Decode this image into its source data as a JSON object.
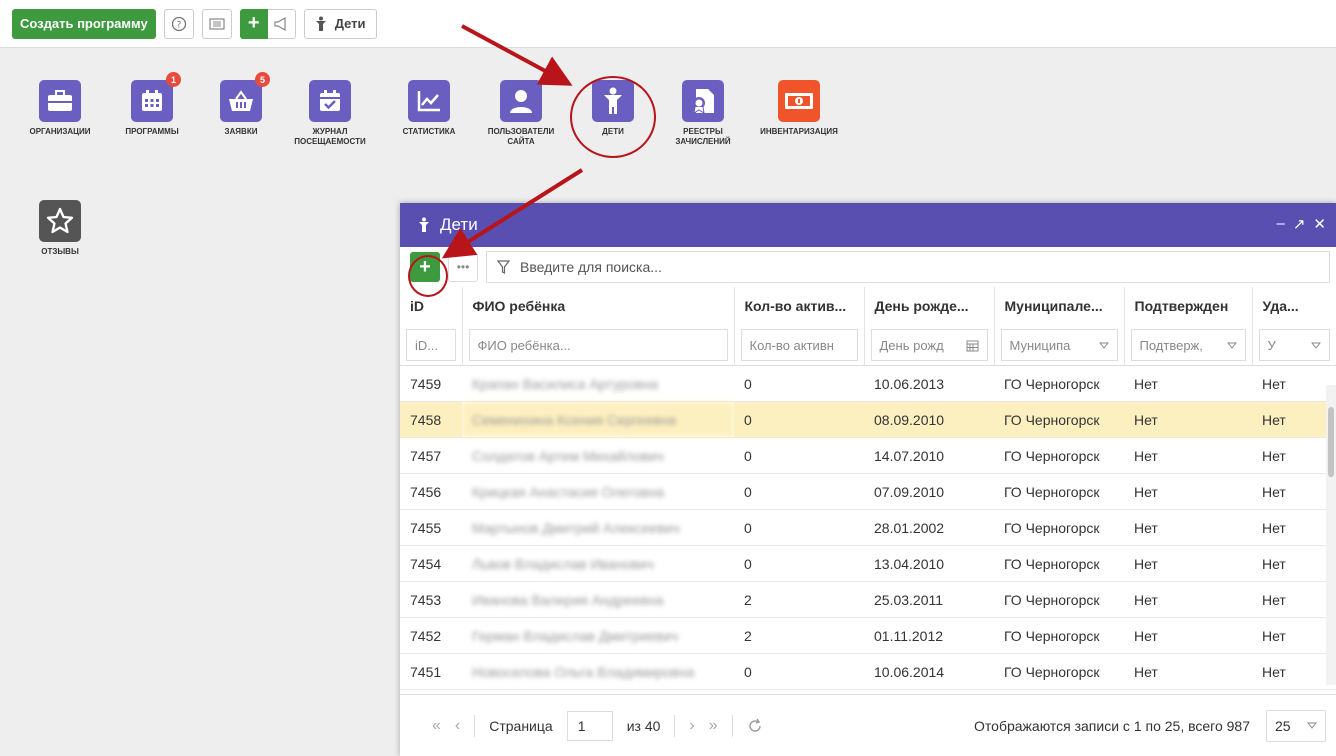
{
  "toolbar": {
    "create_label": "Создать программу",
    "help_icon": "help-icon",
    "deti_label": "Дети"
  },
  "desktop": {
    "icons": [
      {
        "label": "Организации",
        "icon": "briefcase-icon",
        "badge": ""
      },
      {
        "label": "Программы",
        "icon": "calendar-icon",
        "badge": "1"
      },
      {
        "label": "Заявки",
        "icon": "basket-icon",
        "badge": "5"
      },
      {
        "label": "Журнал посещаемости",
        "icon": "calendar-check-icon",
        "badge": ""
      },
      {
        "label": "Статистика",
        "icon": "chart-icon",
        "badge": ""
      },
      {
        "label": "Пользователи сайта",
        "icon": "user-icon",
        "badge": ""
      },
      {
        "label": "Дети",
        "icon": "child-icon",
        "badge": ""
      },
      {
        "label": "Реестры зачислений",
        "icon": "certificate-icon",
        "badge": ""
      },
      {
        "label": "Инвентаризация",
        "icon": "money-icon",
        "badge": ""
      },
      {
        "label": "Отзывы",
        "icon": "star-icon",
        "badge": ""
      }
    ]
  },
  "window": {
    "title": "Дети",
    "search_placeholder": "Введите для поиска...",
    "columns": [
      "iD",
      "ФИО ребёнка",
      "Кол-во актив...",
      "День рожде...",
      "Муниципале...",
      "Подтвержден",
      "Уда..."
    ],
    "filters": [
      "iD...",
      "ФИО ребёнка...",
      "Кол-во активн",
      "День рожд",
      "Муниципа",
      "Подтверж,",
      "У"
    ],
    "rows": [
      {
        "id": "7459",
        "name": "Крапан Василиса Артуровна",
        "count": "0",
        "birth": "10.06.2013",
        "mun": "ГО Черногорск",
        "conf": "Нет",
        "del": "Нет"
      },
      {
        "id": "7458",
        "name": "Семенихина Ксения Сергеевна",
        "count": "0",
        "birth": "08.09.2010",
        "mun": "ГО Черногорск",
        "conf": "Нет",
        "del": "Нет"
      },
      {
        "id": "7457",
        "name": "Солдатов Артем Михайлович",
        "count": "0",
        "birth": "14.07.2010",
        "mun": "ГО Черногорск",
        "conf": "Нет",
        "del": "Нет"
      },
      {
        "id": "7456",
        "name": "Крицкая Анастасия Олеговна",
        "count": "0",
        "birth": "07.09.2010",
        "mun": "ГО Черногорск",
        "conf": "Нет",
        "del": "Нет"
      },
      {
        "id": "7455",
        "name": "Мартынов Дмитрий Алексеевич",
        "count": "0",
        "birth": "28.01.2002",
        "mun": "ГО Черногорск",
        "conf": "Нет",
        "del": "Нет"
      },
      {
        "id": "7454",
        "name": "Львов Владислав Иванович",
        "count": "0",
        "birth": "13.04.2010",
        "mun": "ГО Черногорск",
        "conf": "Нет",
        "del": "Нет"
      },
      {
        "id": "7453",
        "name": "Иванова Валерия Андреевна",
        "count": "2",
        "birth": "25.03.2011",
        "mun": "ГО Черногорск",
        "conf": "Нет",
        "del": "Нет"
      },
      {
        "id": "7452",
        "name": "Герман Владислав Дмитриевич",
        "count": "2",
        "birth": "01.11.2012",
        "mun": "ГО Черногорск",
        "conf": "Нет",
        "del": "Нет"
      },
      {
        "id": "7451",
        "name": "Новоселова Ольга Владимировна",
        "count": "0",
        "birth": "10.06.2014",
        "mun": "ГО Черногорск",
        "conf": "Нет",
        "del": "Нет"
      }
    ],
    "pager": {
      "page_label": "Страница",
      "page": "1",
      "of_label": "из 40",
      "info": "Отображаются записи с 1 по 25, всего 987",
      "per_page": "25"
    }
  },
  "colors": {
    "accent_green": "#3d9a3f",
    "header_purple": "#584fb1",
    "tile_purple": "#6a5fc1",
    "highlight_red": "#b8141a",
    "selected_row": "#fdf0c0"
  }
}
